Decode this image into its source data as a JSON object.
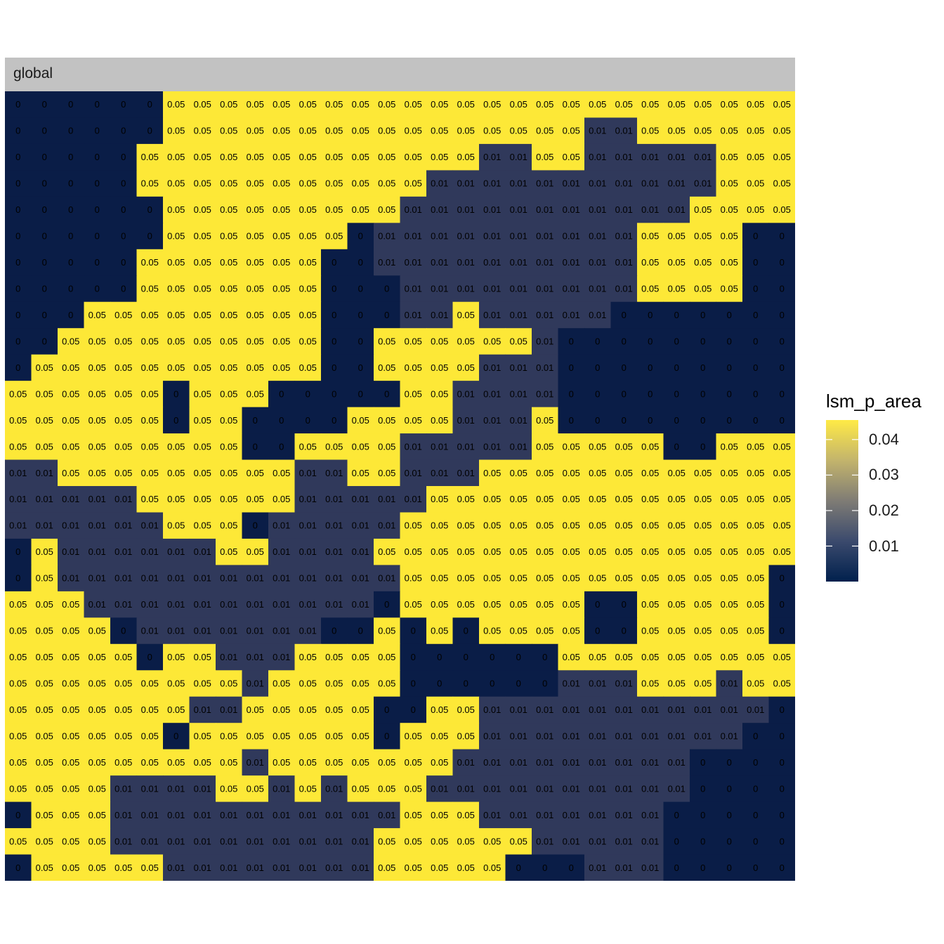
{
  "facet_label": "global",
  "chart_data": {
    "type": "heatmap",
    "title": "",
    "xlabel": "",
    "ylabel": "",
    "ncol": 30,
    "nrow": 30,
    "rows": [
      "000000222222222222222222222222",
      "000000222222222222222211222222",
      "000002222222222222112211111222",
      "000002222222222211111111111222",
      "000000222222222111111111112222",
      "000000222222201111111111222200",
      "000002222222001111111111222200",
      "000002222222000111111111222200",
      "000222222222000112111110000000",
      "002222222222002222221000000000",
      "022222222222002222111000000000",
      "222222022200000221111000000000",
      "222222022000022221112000000000",
      "222222222002222111112222200222",
      "112222222221122111222222222222",
      "111112222221111122222222222222",
      "111111222011111222222222222222",
      "021111112211112222222222222222",
      "021111111111111222222222222220",
      "222111111111110222222200222220",
      "222201111111002020222200222220",
      "222220221112222000000222222222",
      "222222222122222000000111222122",
      "222222211222220022111111111110",
      "222222022222220222111111111100",
      "222222222122222221111111110000",
      "222211112212122211111111110000",
      "022211111111111222111111100000",
      "222211111111112222221111100000",
      "022222111111112222200011100000"
    ],
    "level_values": [
      "0",
      "0.01",
      "0.05"
    ],
    "level_colors": [
      "#0a1d47",
      "#30395b",
      "#fde837"
    ],
    "level_text_colors": [
      "#000000",
      "#000000",
      "#000000"
    ],
    "legend": {
      "title": "lsm_p_area",
      "breaks": [
        "0.04",
        "0.03",
        "0.02",
        "0.01"
      ],
      "break_values": [
        0.04,
        0.03,
        0.02,
        0.01
      ],
      "range": [
        0,
        0.0455
      ],
      "position": "right",
      "colors": [
        "#00204d",
        "#3b4a6d",
        "#7f7c75",
        "#c3b46c",
        "#ffea46"
      ]
    }
  }
}
